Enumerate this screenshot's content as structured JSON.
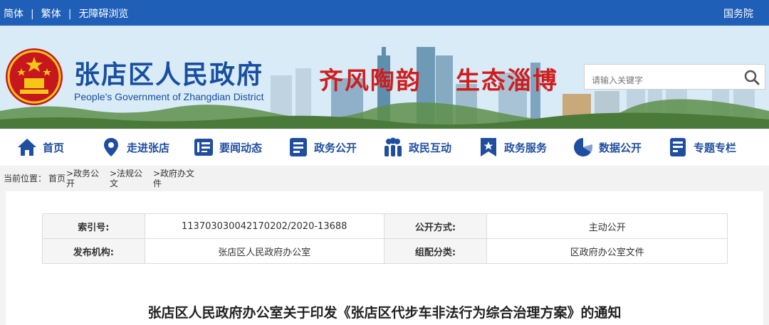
{
  "topbar": {
    "simplified": "简体",
    "traditional": "繁体",
    "accessible": "无障碍浏览",
    "separator": "|",
    "right_link": "国务院"
  },
  "banner": {
    "title": "张店区人民政府",
    "subtitle": "People's Government of Zhangdian District",
    "slogan_left": "齐风陶韵",
    "slogan_right": "生态淄博",
    "search_placeholder": "请输入关键字"
  },
  "nav": {
    "items": [
      {
        "label": "首页",
        "icon": "home-icon"
      },
      {
        "label": "走进张店",
        "icon": "location-pin-icon"
      },
      {
        "label": "要闻动态",
        "icon": "news-list-icon"
      },
      {
        "label": "政务公开",
        "icon": "document-icon"
      },
      {
        "label": "政民互动",
        "icon": "people-icon"
      },
      {
        "label": "政务服务",
        "icon": "bookmark-star-icon"
      },
      {
        "label": "数据公开",
        "icon": "pie-chart-icon"
      },
      {
        "label": "专题专栏",
        "icon": "file-list-icon"
      }
    ]
  },
  "breadcrumb": {
    "prefix": "当前位置：",
    "home": "首页",
    "path1": ">政务公开",
    "path2": ">法规公文",
    "path3": ">政府办文件"
  },
  "meta": {
    "index_label": "索引号:",
    "index_value": "11370303004217020​2/2020-13688",
    "open_label": "公开方式:",
    "open_value": "主动公开",
    "publisher_label": "发布机构:",
    "publisher_value": "张店区人民政府办公室",
    "category_label": "组配分类:",
    "category_value": "区政府办公室文件"
  },
  "document": {
    "title": "张店区人民政府办公室关于印发《张店区代步车非法行为综合治理方案》的通知"
  },
  "colors": {
    "primary_blue": "#1f5fb7",
    "nav_text": "#1f4ea1",
    "slogan_red": "#cf1d1d"
  }
}
